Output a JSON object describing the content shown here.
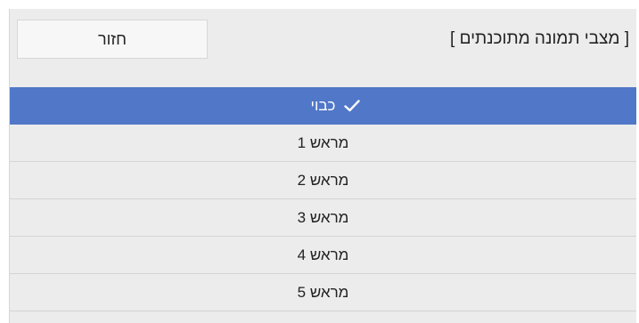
{
  "header": {
    "title": "[ מצבי תמונה מתוכנתים ]",
    "back_label": "חזור"
  },
  "list": {
    "selected_index": 0,
    "items": [
      {
        "label": "כבוי",
        "checked": true
      },
      {
        "label": "מראש 1",
        "checked": false
      },
      {
        "label": "מראש 2",
        "checked": false
      },
      {
        "label": "מראש 3",
        "checked": false
      },
      {
        "label": "מראש 4",
        "checked": false
      },
      {
        "label": "מראש 5",
        "checked": false
      }
    ]
  },
  "colors": {
    "selection": "#5177c8",
    "panel_background": "#ececec",
    "row_divider": "#d4d4d4"
  },
  "icons": {
    "check": "check-icon"
  }
}
